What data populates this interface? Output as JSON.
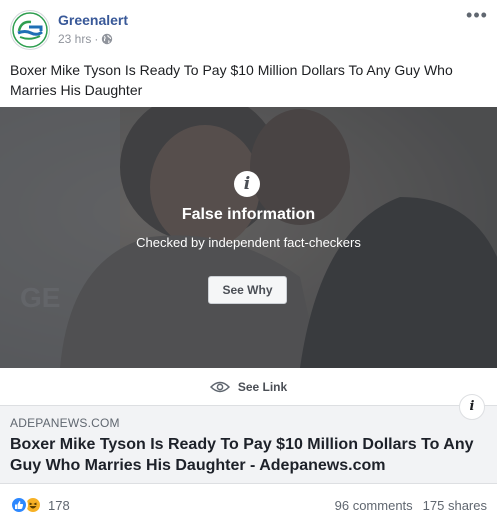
{
  "header": {
    "page_name": "Greenalert",
    "time": "23 hrs",
    "separator": "·",
    "privacy_icon": "globe-icon",
    "more_icon": "more-options-icon",
    "more_label": "•••"
  },
  "caption": "Boxer Mike Tyson Is Ready To Pay $10 Million Dollars To Any Guy Who Marries His Daughter",
  "fact_check": {
    "icon": "info-icon",
    "icon_glyph": "i",
    "title": "False information",
    "subtitle": "Checked by independent fact-checkers",
    "button_label": "See Why"
  },
  "see_link": {
    "icon": "eye-icon",
    "label": "See Link"
  },
  "link_preview": {
    "domain": "ADEPANEWS.COM",
    "title": "Boxer Mike Tyson Is Ready To Pay $10 Million Dollars To Any Guy Who Marries His Daughter - Adepanews.com",
    "info_glyph": "i"
  },
  "footer": {
    "reaction_icons": [
      "like-icon",
      "haha-icon"
    ],
    "reaction_count": "178",
    "comments": "96 comments",
    "shares": "175 shares"
  },
  "colors": {
    "brand_link": "#385898",
    "secondary_text": "#606770",
    "like_blue": "#2d88ff",
    "haha_yellow": "#f7b125"
  }
}
